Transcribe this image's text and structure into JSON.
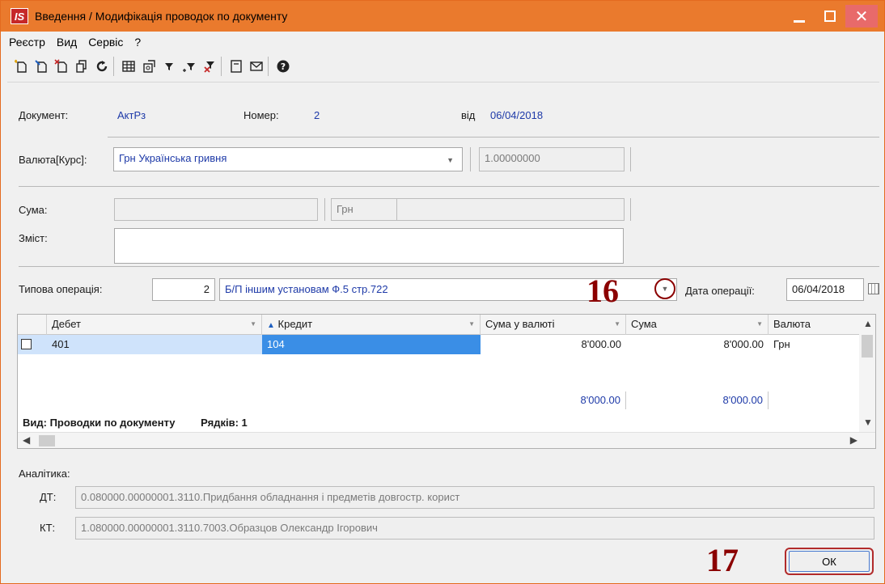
{
  "window": {
    "logo": "IS",
    "title": "Введення / Модифікація проводок по документу",
    "buttons": {
      "minimize": "minimize",
      "maximize": "maximize",
      "close": "✕"
    }
  },
  "menu": [
    "Реєстр",
    "Вид",
    "Сервіс",
    "?"
  ],
  "toolbar_icons": [
    "add-icon",
    "edit-icon",
    "delete-icon",
    "copy-icon",
    "refresh-icon",
    "table-icon",
    "export-icon",
    "filter-icon",
    "filter-add-icon",
    "filter-clear-icon",
    "form-icon",
    "mail-icon",
    "help-icon"
  ],
  "doc": {
    "document_label": "Документ:",
    "document_value": "АктРз",
    "number_label": "Номер:",
    "number_value": "2",
    "date_label": "від",
    "date_value": "06/04/2018"
  },
  "currency": {
    "label": "Валюта[Курс]:",
    "value": "Грн Українська гривня",
    "rate": "1.00000000"
  },
  "sum": {
    "label": "Сума:",
    "amount": "",
    "currency": "Грн",
    "extra": ""
  },
  "content": {
    "label": "Зміст:",
    "value": ""
  },
  "operation": {
    "label": "Типова операція:",
    "code": "2",
    "name": "Б/П іншим установам Ф.5 стр.722",
    "date_label": "Дата операції:",
    "date_value": "06/04/2018"
  },
  "grid": {
    "columns": [
      "Дебет",
      "Кредит",
      "Сума у валюті",
      "Сума",
      "Валюта"
    ],
    "rows": [
      {
        "debit": "401",
        "credit": "104",
        "sum_currency": "8'000.00",
        "sum": "8'000.00",
        "currency": "Грн"
      }
    ],
    "totals": {
      "sum_currency": "8'000.00",
      "sum": "8'000.00"
    },
    "view_label": "Вид: Проводки по документу",
    "rows_label": "Рядків: 1"
  },
  "analytics": {
    "label": "Аналітика:",
    "dt_label": "ДТ:",
    "dt_value": "0.080000.00000001.3110.Придбання обладнання і предметів довгостр. корист",
    "kt_label": "КТ:",
    "kt_value": "1.080000.00000001.3110.7003.Образцов Олександр Ігорович"
  },
  "ok_label": "ОК",
  "annotations": {
    "step16": "16",
    "step17": "17"
  }
}
